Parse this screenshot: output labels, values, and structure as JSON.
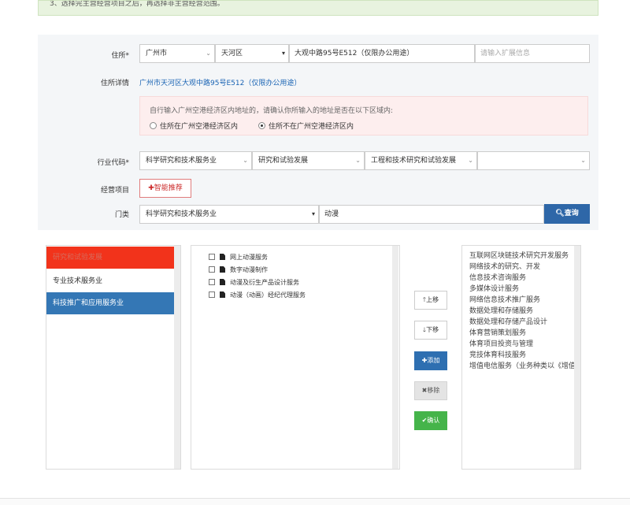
{
  "notice": {
    "text": "3、选择完主营经营项目之后，再选择非主营经营范围。"
  },
  "address": {
    "label": "住所*",
    "city": "广州市",
    "district": "天河区",
    "street": "大观中路95号E512（仅限办公用途）",
    "extra_placeholder": "请输入扩展信息",
    "detail_label": "住所详情",
    "detail_value": "广州市天河区大观中路95号E512（仅限办公用途）",
    "zone_hint": "自行输入广州空港经济区内地址的，请确认你所输入的地址是否在以下区域内:",
    "radio_in": "住所在广州空港经济区内",
    "radio_out": "住所不在广州空港经济区内",
    "selected_radio": "out"
  },
  "industry": {
    "label": "行业代码*",
    "level1": "科学研究和技术服务业",
    "level2": "研究和试验发展",
    "level3": "工程和技术研究和试验发展",
    "level4": ""
  },
  "business": {
    "label": "经营项目",
    "smart_button": "✚智能推荐"
  },
  "category": {
    "label": "门类",
    "selected": "科学研究和技术服务业",
    "keyword": "动漫",
    "query_button": "查询"
  },
  "left_list": {
    "items": [
      {
        "label": "研究和试验发展",
        "state": "selected-red"
      },
      {
        "label": "专业技术服务业",
        "state": "normal"
      },
      {
        "label": "科技推广和应用服务业",
        "state": "active-blue"
      }
    ]
  },
  "tree": {
    "items": [
      "网上动漫服务",
      "数字动漫制作",
      "动漫及衍生产品设计服务",
      "动漫（动画）经纪代理服务"
    ]
  },
  "actions": {
    "up": "上移",
    "down": "下移",
    "add": "添加",
    "remove": "移除",
    "confirm": "确认"
  },
  "selected_list": {
    "items": [
      "互联网区块链技术研究开发服务",
      "网络技术的研究、开发",
      "信息技术咨询服务",
      "多媒体设计服务",
      "网络信息技术推广服务",
      "数据处理和存储服务",
      "数据处理和存储产品设计",
      "体育营销策划服务",
      "体育项目投资与管理",
      "竞技体育科技服务",
      "增值电信服务（业务种类以《增值电信业务经营许可证》载明内容为准）"
    ]
  },
  "colors": {
    "primary_blue": "#2e67a8",
    "danger_red": "#f2331b",
    "success_green": "#45b44a",
    "notice_bg": "#e8f3df",
    "zone_bg": "#fdeeee"
  }
}
